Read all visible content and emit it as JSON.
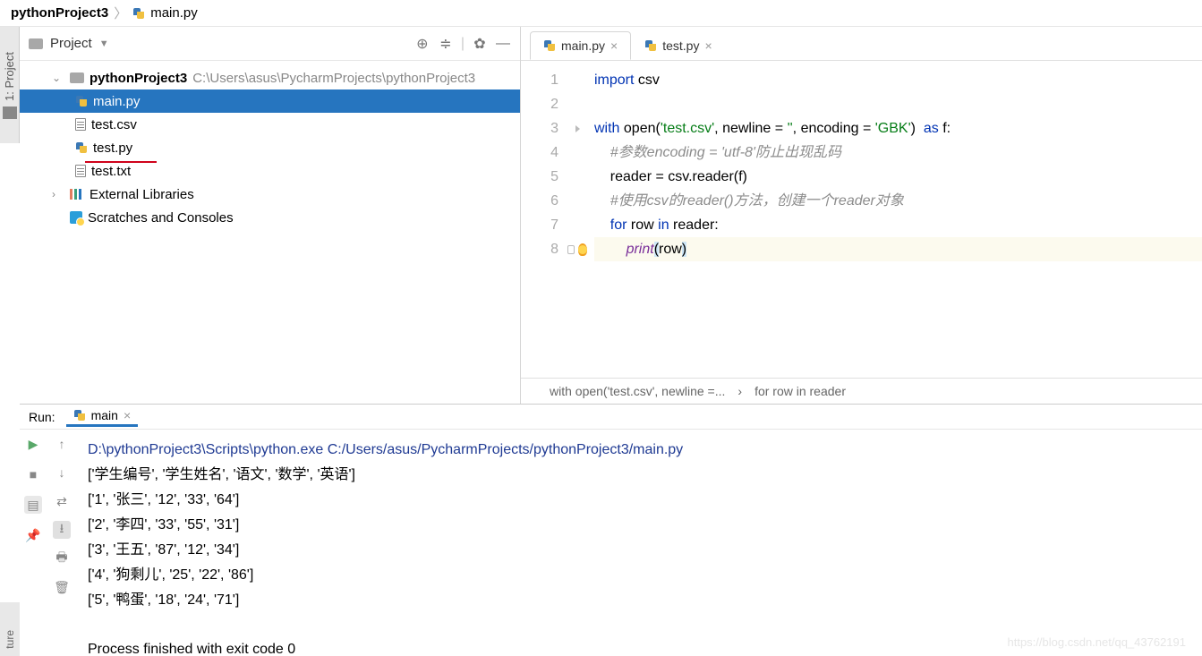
{
  "breadcrumb": {
    "project": "pythonProject3",
    "file": "main.py"
  },
  "sidebar_label": "1: Project",
  "project_pane": {
    "title": "Project",
    "root": {
      "name": "pythonProject3",
      "path": "C:\\Users\\asus\\PycharmProjects\\pythonProject3"
    },
    "files": [
      {
        "name": "main.py",
        "type": "py",
        "selected": true
      },
      {
        "name": "test.csv",
        "type": "file"
      },
      {
        "name": "test.py",
        "type": "py"
      },
      {
        "name": "test.txt",
        "type": "file"
      }
    ],
    "external": "External Libraries",
    "scratches": "Scratches and Consoles"
  },
  "tabs": [
    {
      "name": "main.py",
      "active": true
    },
    {
      "name": "test.py",
      "active": false
    }
  ],
  "code": {
    "lines": [
      "import csv",
      "",
      "with open('test.csv', newline = '', encoding = 'GBK')  as f:",
      "    #参数encoding = 'utf-8'防止出现乱码",
      "    reader = csv.reader(f)",
      "    #使用csv的reader()方法，创建一个reader对象",
      "    for row in reader:",
      "        print(row)"
    ],
    "kw_import": "import",
    "mod_csv": " csv",
    "kw_with": "with ",
    "fn_open": "open",
    "paren_o": "(",
    "str_file": "'test.csv'",
    "comma1": ", ",
    "arg_newline": "newline ",
    "eq": "= ",
    "str_empty": "''",
    "comma2": ", ",
    "arg_enc": "encoding ",
    "str_gbk": "'GBK'",
    "paren_c": ")",
    "kw_as": "  as ",
    "var_f": "f:",
    "comment1": "#参数encoding = 'utf-8'防止出现乱码",
    "line5a": "    reader = csv.reader(f)",
    "comment2": "#使用csv的reader()方法，创建一个reader对象",
    "kw_for": "for ",
    "var_row": "row ",
    "kw_in": "in ",
    "var_reader": "reader:",
    "fn_print": "print",
    "arg_row": "row"
  },
  "crumb": {
    "a": "with open('test.csv', newline =...",
    "b": "for row in reader"
  },
  "run": {
    "label": "Run:",
    "tab": "main",
    "command": "D:\\pythonProject3\\Scripts\\python.exe C:/Users/asus/PycharmProjects/pythonProject3/main.py",
    "output": [
      "['学生编号', '学生姓名', '语文', '数学', '英语']",
      "['1', '张三', '12', '33', '64']",
      "['2', '李四', '33', '55', '31']",
      "['3', '王五', '87', '12', '34']",
      "['4', '狗剩儿', '25', '22', '86']",
      "['5', '鸭蛋', '18', '24', '71']"
    ],
    "exit": "Process finished with exit code 0"
  },
  "watermark": "https://blog.csdn.net/qq_43762191",
  "bottom_tab": "ture"
}
